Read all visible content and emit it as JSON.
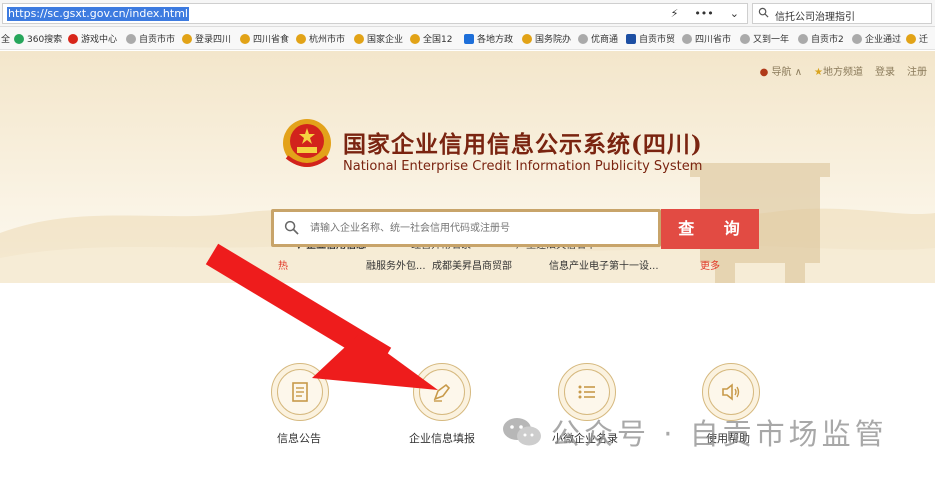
{
  "browser": {
    "url": "https://sc.gsxt.gov.cn/index.html",
    "search_text": "信托公司治理指引",
    "icon_names": [
      "lightning-icon",
      "more-icon",
      "chevron-down-icon",
      "search-icon"
    ]
  },
  "bookmarks": [
    "全",
    "360搜索",
    "游戏中心",
    "自贡市市",
    "登录四川",
    "四川省食",
    "杭州市市",
    "国家企业",
    "全国12",
    "各地方政",
    "国务院办",
    "优商通",
    "自贡市贸",
    "四川省市",
    "又到一年",
    "自贡市2",
    "企业通过",
    "迁"
  ],
  "hero": {
    "nav": "导航",
    "region": "地方频道",
    "login": "登录",
    "register": "注册",
    "title_cn": "国家企业信用信息公示系统(四川)",
    "title_en": "National Enterprise Credit Information Publicity System"
  },
  "tabs": [
    "企业信用信息",
    "经营异常名录",
    "严重违法失信名单"
  ],
  "search": {
    "placeholder": "请输入企业名称、统一社会信用代码或注册号",
    "button": "查 询"
  },
  "hot": {
    "items": [
      "热",
      "融服务外包...",
      "成都美昇昌商贸部",
      "信息产业电子第十一设...",
      "更多"
    ]
  },
  "services": [
    "信息公告",
    "企业信息填报",
    "小微企业名录",
    "使用帮助"
  ],
  "watermark": "公众号 · 自贡市场监管",
  "colors": {
    "brand_red": "#e24b43",
    "title_brown": "#7a2410",
    "gold": "#c8a46a",
    "arrow_red": "#ee1c1c"
  }
}
